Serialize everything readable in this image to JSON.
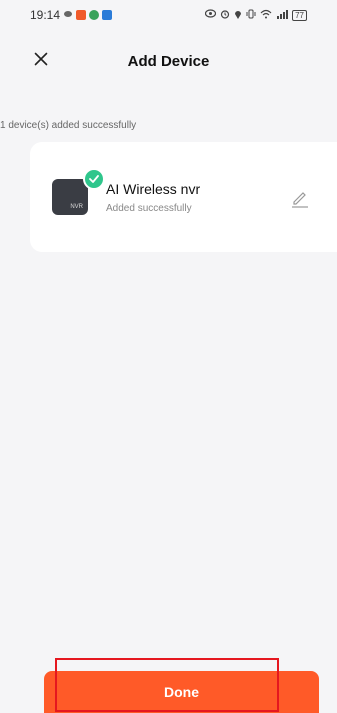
{
  "status_bar": {
    "time": "19:14",
    "battery": "77",
    "icons": [
      "notification-icon",
      "app-icon-orange",
      "app-icon-green",
      "app-icon-blue",
      "eye-icon",
      "alarm-icon",
      "location-icon",
      "vibrate-icon",
      "wifi-icon",
      "signal-icon",
      "battery-icon"
    ]
  },
  "header": {
    "title": "Add Device",
    "close_icon": "close-icon"
  },
  "info_text": "1 device(s) added successfully",
  "device": {
    "name": "AI Wireless nvr",
    "status": "Added successfully",
    "thumb_label": "NVR",
    "check_icon": "check-icon",
    "edit_icon": "pencil-icon"
  },
  "done_button": {
    "label": "Done"
  },
  "colors": {
    "accent": "#ff5a28",
    "success": "#2fc68c",
    "highlight": "#e5171f",
    "background": "#f5f5f7"
  }
}
